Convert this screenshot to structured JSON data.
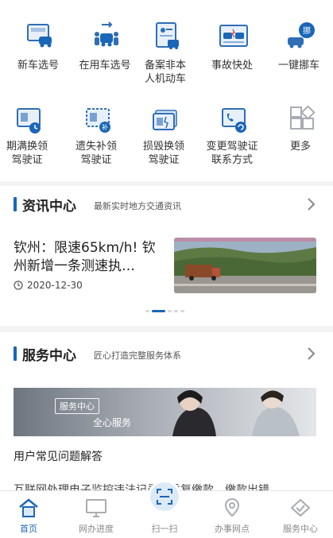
{
  "services": [
    {
      "icon": "new-car-plate-icon",
      "label": [
        "新车选号"
      ]
    },
    {
      "icon": "used-car-plate-icon",
      "label": [
        "在用车选号"
      ]
    },
    {
      "icon": "non-motor-vehicle-icon",
      "label": [
        "备案非本",
        "人机动车"
      ]
    },
    {
      "icon": "accident-report-icon",
      "label": [
        "事故快处"
      ]
    },
    {
      "icon": "move-car-icon",
      "label": [
        "一键挪车"
      ]
    },
    {
      "icon": "license-renew-icon",
      "label": [
        "期满换领",
        "驾驶证"
      ]
    },
    {
      "icon": "license-lost-icon",
      "label": [
        "遗失补领",
        "驾驶证"
      ]
    },
    {
      "icon": "license-damaged-icon",
      "label": [
        "损毁换领",
        "驾驶证"
      ]
    },
    {
      "icon": "license-contact-icon",
      "label": [
        "变更驾驶证",
        "联系方式"
      ]
    },
    {
      "icon": "more-icon",
      "label": [
        "更多"
      ]
    }
  ],
  "news": {
    "title": "资讯中心",
    "subtitle": "最新实时地方交通资讯",
    "headline": "钦州：限速65km/h! 钦州新增一条测速执…",
    "date": "2020-12-30",
    "dots_count": 5,
    "active_dot": 1
  },
  "service_center": {
    "title": "服务中心",
    "subtitle": "匠心打造完整服务体系",
    "banner_badge": "服务中心",
    "banner_text": "全心服务",
    "faq_label": "用户常见问题解答",
    "next_item": "互联网处理电子监控违法记录、重复缴款、缴款出错"
  },
  "tabs": [
    {
      "icon": "home-icon",
      "label": "首页",
      "active": true
    },
    {
      "icon": "monitor-icon",
      "label": "网办进度",
      "active": false
    },
    {
      "icon": "scan-icon",
      "label": "扫一扫",
      "active": false
    },
    {
      "icon": "location-pin-icon",
      "label": "办事网点",
      "active": false
    },
    {
      "icon": "service-handshake-icon",
      "label": "服务中心",
      "active": false
    }
  ],
  "colors": {
    "accent": "#1a66b8",
    "accent_light": "#dce9f7",
    "text": "#222222",
    "muted": "#888888"
  }
}
